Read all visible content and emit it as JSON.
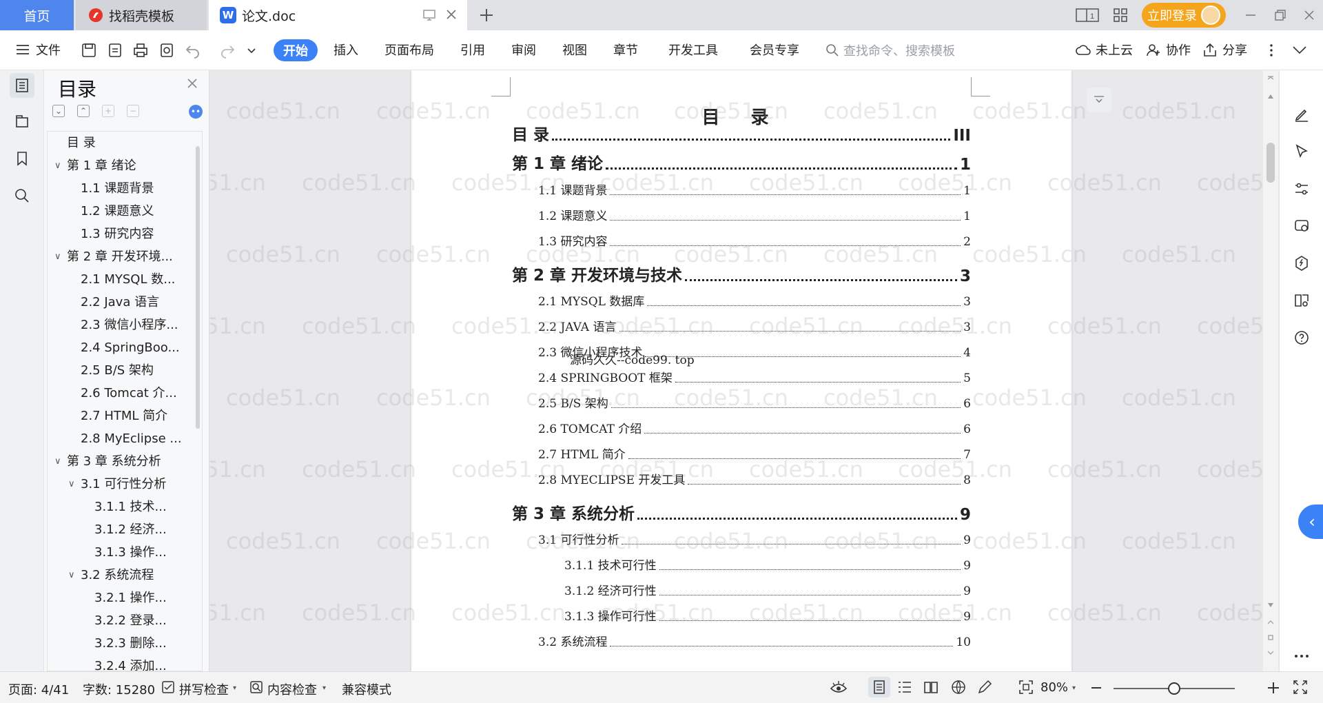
{
  "tabs": {
    "home": "首页",
    "daoke": "找稻壳模板",
    "doc": "论文.doc"
  },
  "header": {
    "login": "立即登录"
  },
  "toolbar": {
    "file": "文件",
    "menu": [
      "开始",
      "插入",
      "页面布局",
      "引用",
      "审阅",
      "视图",
      "章节",
      "开发工具",
      "会员专享"
    ],
    "search_placeholder": "查找命令、搜索模板",
    "cloud": "未上云",
    "collab": "协作",
    "share": "分享"
  },
  "outline": {
    "title": "目录",
    "items": [
      {
        "text": "目  录",
        "level": 0,
        "caret": ""
      },
      {
        "text": "第 1 章  绪论",
        "level": 0,
        "caret": "open"
      },
      {
        "text": "1.1  课题背景",
        "level": 1,
        "caret": ""
      },
      {
        "text": "1.2  课题意义",
        "level": 1,
        "caret": ""
      },
      {
        "text": "1.3  研究内容",
        "level": 1,
        "caret": ""
      },
      {
        "text": "第 2 章  开发环境...",
        "level": 0,
        "caret": "open"
      },
      {
        "text": "2.1 MYSQL 数...",
        "level": 1,
        "caret": ""
      },
      {
        "text": "2.2 Java 语言",
        "level": 1,
        "caret": ""
      },
      {
        "text": "2.3  微信小程序...",
        "level": 1,
        "caret": ""
      },
      {
        "text": "2.4 SpringBoo...",
        "level": 1,
        "caret": ""
      },
      {
        "text": "2.5 B/S 架构",
        "level": 1,
        "caret": ""
      },
      {
        "text": "2.6 Tomcat 介...",
        "level": 1,
        "caret": ""
      },
      {
        "text": "2.7 HTML 简介",
        "level": 1,
        "caret": ""
      },
      {
        "text": "2.8 MyEclipse ...",
        "level": 1,
        "caret": ""
      },
      {
        "text": "第 3 章  系统分析",
        "level": 0,
        "caret": "open"
      },
      {
        "text": "3.1  可行性分析",
        "level": 1,
        "caret": "open"
      },
      {
        "text": "3.1.1  技术...",
        "level": 2,
        "caret": ""
      },
      {
        "text": "3.1.2  经济...",
        "level": 2,
        "caret": ""
      },
      {
        "text": "3.1.3  操作...",
        "level": 2,
        "caret": ""
      },
      {
        "text": "3.2  系统流程",
        "level": 1,
        "caret": "open"
      },
      {
        "text": "3.2.1  操作...",
        "level": 2,
        "caret": ""
      },
      {
        "text": "3.2.2  登录...",
        "level": 2,
        "caret": ""
      },
      {
        "text": "3.2.3  删除...",
        "level": 2,
        "caret": ""
      },
      {
        "text": "3.2.4  添加...",
        "level": 2,
        "caret": ""
      }
    ]
  },
  "document": {
    "title": "目  录",
    "overlay_text": "源码久久--code99. top",
    "watermark": "code51.cn",
    "toc": [
      {
        "label": "目    录",
        "page": "III",
        "level": 0
      },
      {
        "label": "第 1 章  绪论",
        "page": "1",
        "level": 0
      },
      {
        "label": "1.1  课题背景",
        "page": "1",
        "level": 1
      },
      {
        "label": "1.2  课题意义",
        "page": "1",
        "level": 1
      },
      {
        "label": "1.3  研究内容",
        "page": "2",
        "level": 1
      },
      {
        "label": "第 2 章  开发环境与技术",
        "page": "3",
        "level": 0
      },
      {
        "label": "2.1 MYSQL 数据库",
        "page": "3",
        "level": 1
      },
      {
        "label": "2.2 JAVA 语言",
        "page": "3",
        "level": 1
      },
      {
        "label": "2.3  微信小程序技术",
        "page": "4",
        "level": 1
      },
      {
        "label": "2.4 SPRINGBOOT 框架",
        "page": "5",
        "level": 1
      },
      {
        "label": "2.5 B/S 架构",
        "page": "6",
        "level": 1
      },
      {
        "label": "2.6 TOMCAT 介绍",
        "page": "6",
        "level": 1
      },
      {
        "label": "2.7 HTML 简介",
        "page": "7",
        "level": 1
      },
      {
        "label": "2.8 MYECLIPSE 开发工具",
        "page": "8",
        "level": 1
      },
      {
        "label": "第 3 章  系统分析",
        "page": "9",
        "level": 0
      },
      {
        "label": "3.1  可行性分析",
        "page": "9",
        "level": 1
      },
      {
        "label": "3.1.1  技术可行性",
        "page": "9",
        "level": 2
      },
      {
        "label": "3.1.2  经济可行性",
        "page": "9",
        "level": 2
      },
      {
        "label": "3.1.3  操作可行性",
        "page": "9",
        "level": 2
      },
      {
        "label": "3.2  系统流程",
        "page": "10",
        "level": 1
      }
    ]
  },
  "status": {
    "page": "页面: 4/41",
    "words": "字数: 15280",
    "spell": "拼写检查",
    "content": "内容检查",
    "compat": "兼容模式",
    "zoom": "80%",
    "zoom_level": 0.5
  },
  "colors": {
    "accent": "#3b82f6",
    "login": "#f4a51c",
    "home_tab": "#4e86ee"
  }
}
